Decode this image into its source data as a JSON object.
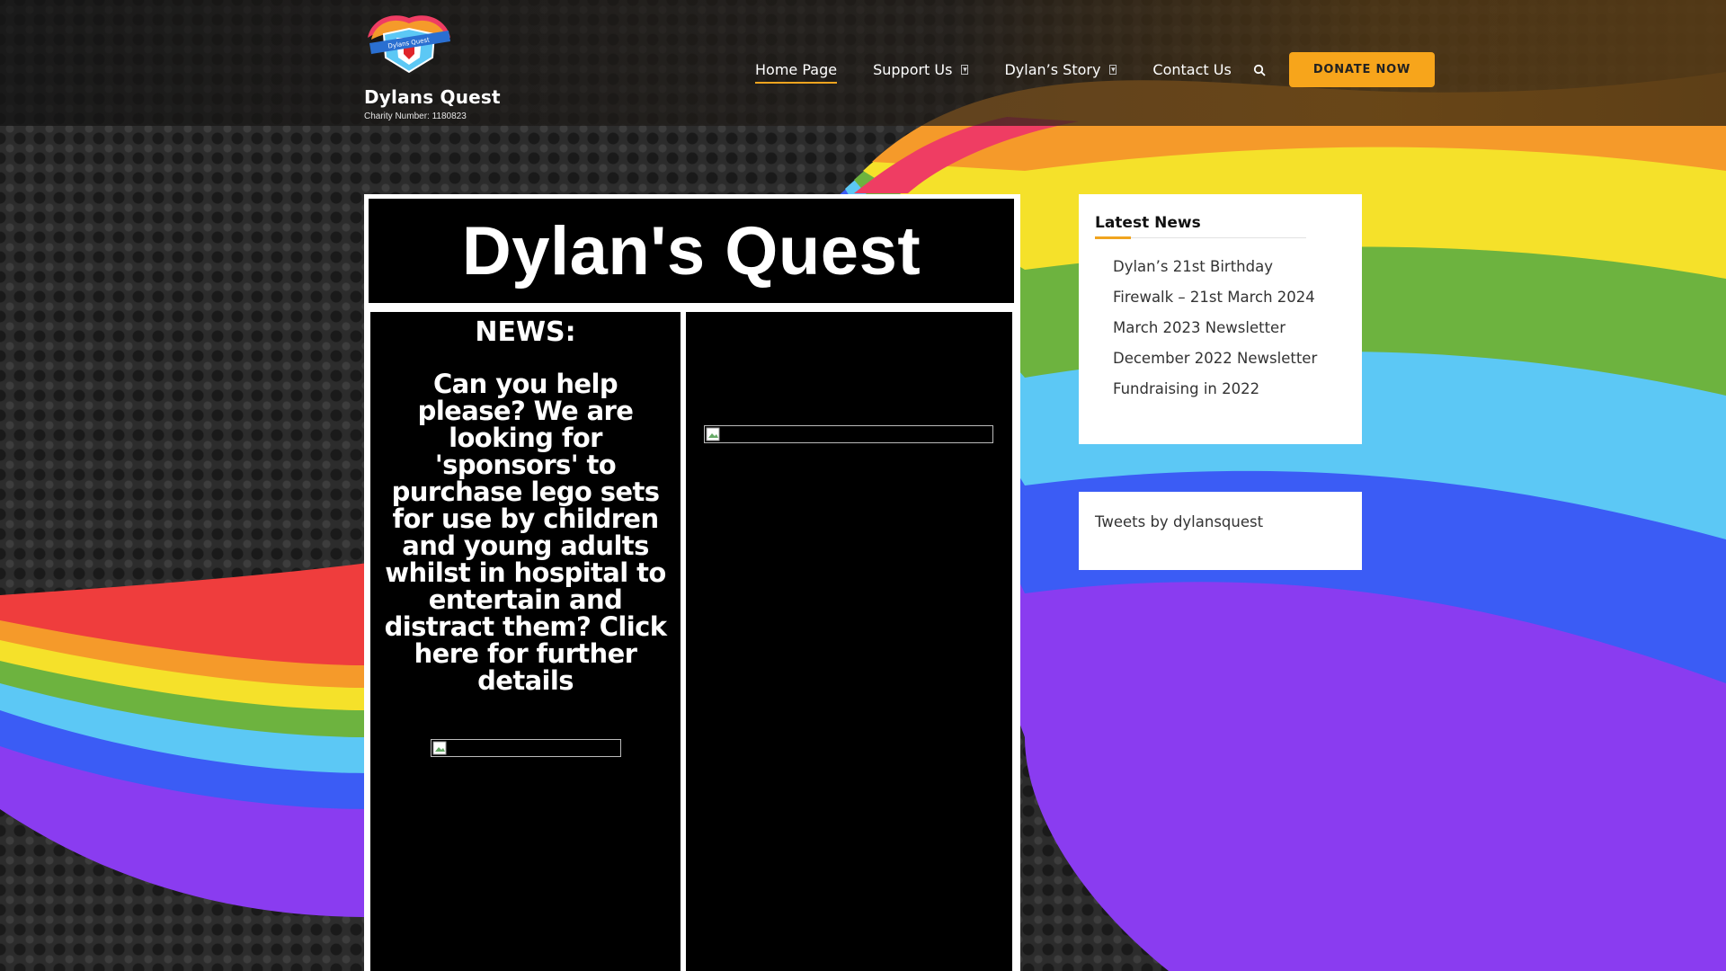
{
  "header": {
    "site_title": "Dylans Quest",
    "charity_number": "Charity Number: 1180823",
    "logo_text": "Dylans Quest",
    "nav": [
      {
        "label": "Home Page",
        "active": true
      },
      {
        "label": "Support Us",
        "has_submenu": true
      },
      {
        "label": "Dylan’s Story",
        "has_submenu": true
      },
      {
        "label": "Contact Us"
      }
    ],
    "search_icon": "search-icon",
    "donate_label": "DONATE NOW"
  },
  "main": {
    "title": "Dylan's Quest",
    "news_heading": "NEWS:",
    "news_body": "Can you help please? We are looking for 'sponsors' to purchase lego sets for use by children and young adults whilst in hospital to entertain and distract them? Click here for further details"
  },
  "sidebar": {
    "latest_news_title": "Latest News",
    "latest_news": [
      "Dylan’s 21st Birthday",
      "Firewalk – 21st March 2024",
      "March 2023 Newsletter",
      "December 2022 Newsletter",
      "Fundraising in 2022"
    ],
    "tweets_label": "Tweets by dylansquest"
  },
  "colors": {
    "accent": "#f7a51b",
    "content_background": "#000000"
  }
}
